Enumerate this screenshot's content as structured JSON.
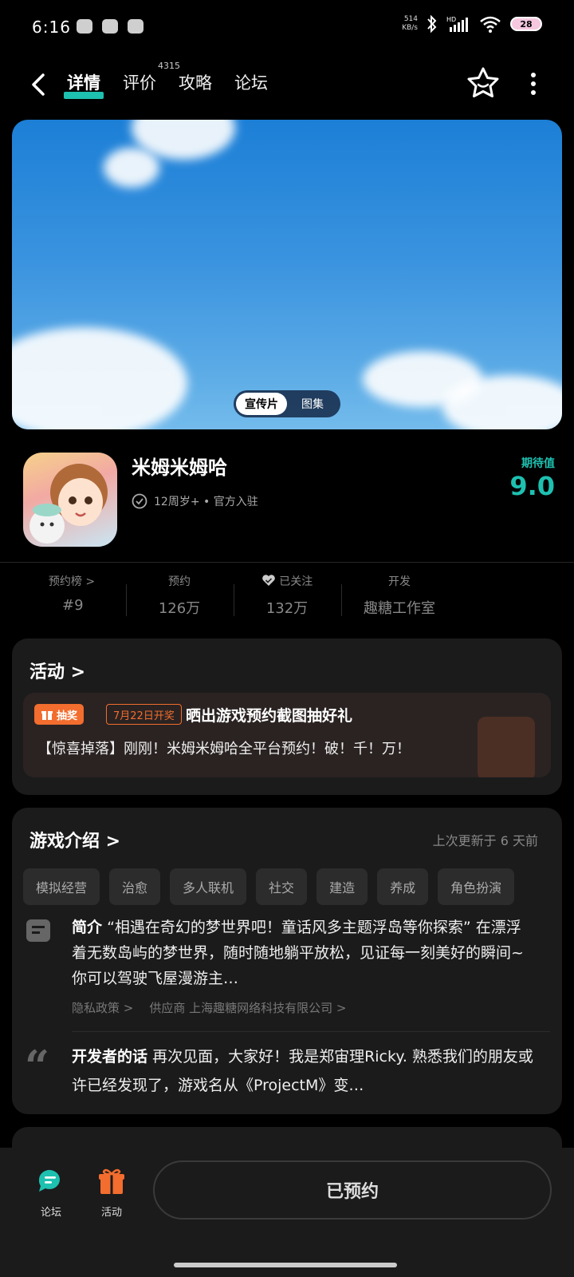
{
  "status": {
    "time": "6:16",
    "net_speed_value": "514",
    "net_speed_unit": "KB/s",
    "network": "HD",
    "battery": "28"
  },
  "header": {
    "tabs": [
      {
        "label": "详情",
        "active": true
      },
      {
        "label": "评价",
        "count": "4315"
      },
      {
        "label": "攻略"
      },
      {
        "label": "论坛"
      }
    ]
  },
  "banner": {
    "toggle": [
      "宣传片",
      "图集"
    ],
    "selected": "宣传片"
  },
  "game": {
    "title": "米姆米姆哈",
    "meta": "12周岁+ • 官方入驻",
    "score_label": "期待值",
    "score": "9.0"
  },
  "stats": [
    {
      "label": "预约榜 >",
      "value": "#9"
    },
    {
      "label": "预约",
      "value": "126万"
    },
    {
      "label": "已关注",
      "value": "132万"
    },
    {
      "label": "开发",
      "value": "趣糖工作室"
    }
  ],
  "activity": {
    "title": "活动 >",
    "tag": "抽奖",
    "date": "7月22日开奖",
    "headline": "晒出游戏预约截图抽好礼",
    "desc": "【惊喜掉落】刚刚！米姆米姆哈全平台预约！破！千！万！"
  },
  "intro": {
    "title": "游戏介绍 >",
    "updated": "上次更新于 6 天前",
    "tags": [
      "模拟经营",
      "治愈",
      "多人联机",
      "社交",
      "建造",
      "养成",
      "角色扮演"
    ],
    "summary_label": "简介",
    "summary": "“相遇在奇幻的梦世界吧！童话风多主题浮岛等你探索” 在漂浮着无数岛屿的梦世界，随时随地躺平放松，见证每一刻美好的瞬间~ 你可以驾驶飞屋漫游主…",
    "privacy_link": "隐私政策 >",
    "supplier_link": "供应商 上海趣糖网络科技有限公司 >",
    "dev_label": "开发者的话",
    "dev_text": "再次见面，大家好！我是郑宙理Ricky. 熟悉我们的朋友或许已经发现了，游戏名从《ProjectM》变…"
  },
  "bottom": {
    "forum_label": "论坛",
    "activity_label": "活动",
    "reserve_label": "已预约"
  },
  "colors": {
    "accent": "#1ec0b0",
    "lottery": "#f26d2e"
  }
}
